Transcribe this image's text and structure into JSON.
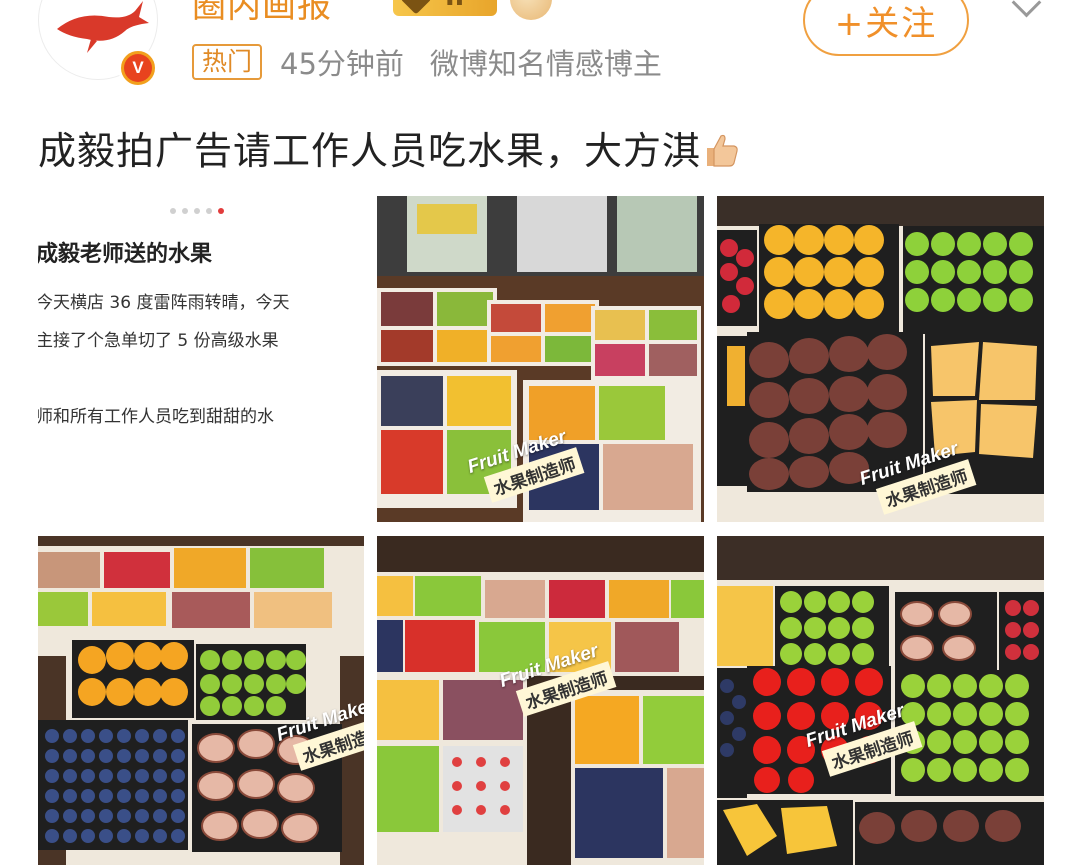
{
  "post": {
    "username": "圈内画报",
    "vip_level": "II",
    "follow_label": "+关注",
    "hot_tag": "热门",
    "time": "45分钟前",
    "author_desc": "微博知名情感博主",
    "text": "成毅拍广告请工作人员吃水果，大方淇"
  },
  "images": {
    "screenshot": {
      "title": "成毅老师送的水果",
      "line1": "今天横店 36 度雷阵雨转晴，今天",
      "line2": "主接了个急单切了 5 份高级水果",
      "line3": "师和所有工作人员吃到甜甜的水"
    },
    "watermark": {
      "en": "Fruit Maker",
      "en_cut": "Fruit Make",
      "zh": "水果制造师"
    }
  },
  "colors": {
    "accent": "#f0902a",
    "meta_gray": "#8b8b8b",
    "vip_gold": "#e8a52b"
  }
}
